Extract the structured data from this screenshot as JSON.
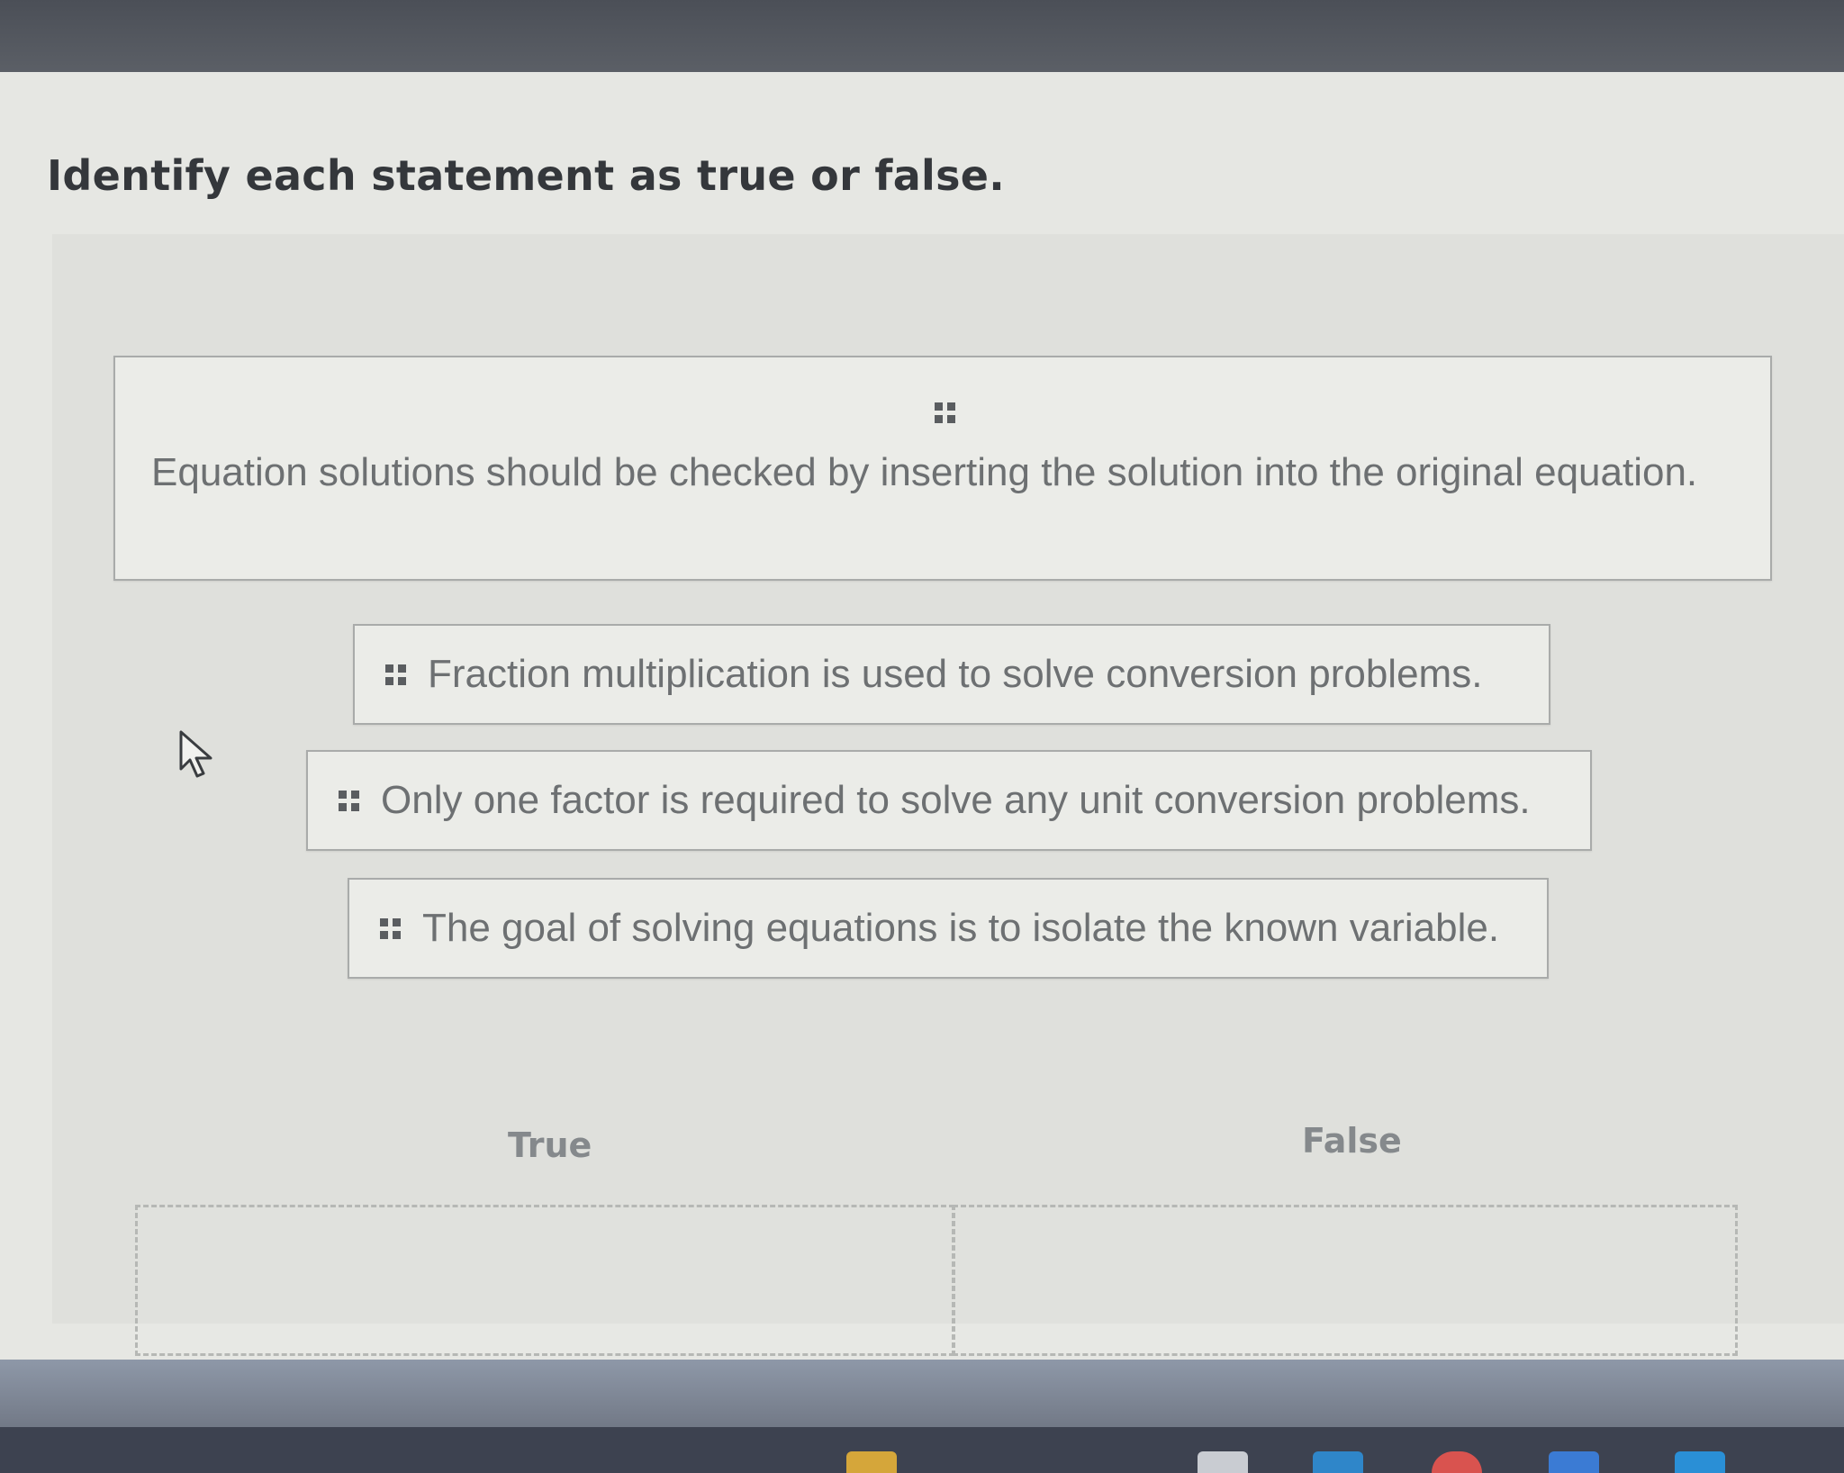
{
  "question": {
    "prompt": "Identify each statement as true or false."
  },
  "statements": [
    {
      "text": "Equation solutions should be checked by inserting the solution into the original equation."
    },
    {
      "text": "Fraction multiplication is used to solve conversion problems."
    },
    {
      "text": "Only one factor is required to solve any unit conversion problems."
    },
    {
      "text": "The goal of solving equations is to isolate the known variable."
    }
  ],
  "categories": {
    "true_label": "True",
    "false_label": "False"
  },
  "icons": {
    "drag_handle": "drag-handle-icon",
    "cursor": "mouse-pointer-icon"
  },
  "colors": {
    "page_background": "#e6e7e3",
    "card_border": "#a9abaa",
    "card_text": "#6d7072",
    "heading_text": "#34373b"
  }
}
